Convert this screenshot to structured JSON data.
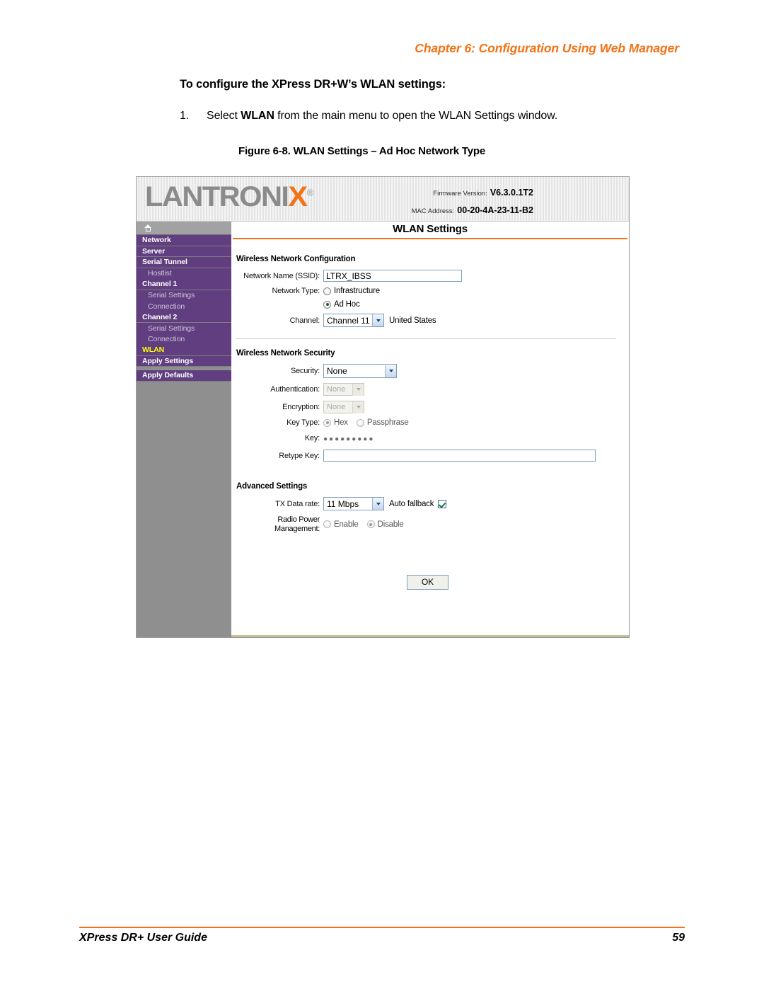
{
  "document": {
    "chapter_header": "Chapter 6: Configuration Using Web Manager",
    "heading": "To configure the XPress DR+W’s WLAN settings:",
    "step": {
      "number": "1.",
      "text_before": "Select ",
      "bold": "WLAN",
      "text_after": " from the main menu to open the WLAN Settings window."
    },
    "figure_caption": "Figure 6-8. WLAN Settings – Ad Hoc Network Type",
    "footer_left": "XPress DR+ User Guide",
    "footer_page": "59",
    "accent_color": "#F47216"
  },
  "screenshot": {
    "brand": {
      "logo_text": "LANTRONI",
      "logo_accent_letter": "X",
      "logo_registered": "®",
      "firmware_label": "Firmware Version:",
      "firmware_value": "V6.3.0.1T2",
      "mac_label": "MAC Address:",
      "mac_value": "00-20-4A-23-11-B2"
    },
    "sidebar": {
      "home_icon": "home-icon",
      "items": [
        {
          "label": "Network",
          "sub": false,
          "active": false
        },
        {
          "label": "Server",
          "sub": false,
          "active": false
        },
        {
          "label": "Serial Tunnel",
          "sub": false,
          "active": false
        },
        {
          "label": "Hostlist",
          "sub": true,
          "active": false
        },
        {
          "label": "Channel 1",
          "sub": false,
          "active": false
        },
        {
          "label": "Serial Settings",
          "sub": true,
          "active": false
        },
        {
          "label": "Connection",
          "sub": true,
          "active": false
        },
        {
          "label": "Channel 2",
          "sub": false,
          "active": false
        },
        {
          "label": "Serial Settings",
          "sub": true,
          "active": false
        },
        {
          "label": "Connection",
          "sub": true,
          "active": false
        },
        {
          "label": "WLAN",
          "sub": false,
          "active": true
        },
        {
          "label": "Apply Settings",
          "sub": false,
          "active": false
        },
        {
          "label": "Apply Defaults",
          "sub": false,
          "active": false
        }
      ]
    },
    "panel": {
      "title": "WLAN Settings",
      "sections": {
        "wireless_network_configuration": {
          "title": "Wireless Network Configuration",
          "ssid_label": "Network Name (SSID):",
          "ssid_value": "LTRX_IBSS",
          "network_type_label": "Network Type:",
          "network_type_options": [
            "Infrastructure",
            "Ad Hoc"
          ],
          "network_type_selected": "Ad Hoc",
          "channel_label": "Channel:",
          "channel_value": "Channel 11",
          "channel_note": "United States"
        },
        "wireless_network_security": {
          "title": "Wireless Network Security",
          "security_label": "Security:",
          "security_value": "None",
          "authentication_label": "Authentication:",
          "authentication_value": "None",
          "authentication_disabled": true,
          "encryption_label": "Encryption:",
          "encryption_value": "None",
          "encryption_disabled": true,
          "key_type_label": "Key Type:",
          "key_type_options": [
            "Hex",
            "Passphrase"
          ],
          "key_type_selected": "Hex",
          "key_label": "Key:",
          "key_value": "●●●●●●●●●",
          "retype_key_label": "Retype Key:",
          "retype_key_value": ""
        },
        "advanced_settings": {
          "title": "Advanced Settings",
          "tx_data_rate_label": "TX Data rate:",
          "tx_data_rate_value": "11 Mbps",
          "auto_fallback_label": "Auto fallback",
          "auto_fallback_checked": true,
          "radio_power_label_line1": "Radio Power",
          "radio_power_label_line2": "Management:",
          "radio_power_options": [
            "Enable",
            "Disable"
          ],
          "radio_power_selected": "Disable"
        }
      },
      "ok_button": "OK"
    }
  }
}
